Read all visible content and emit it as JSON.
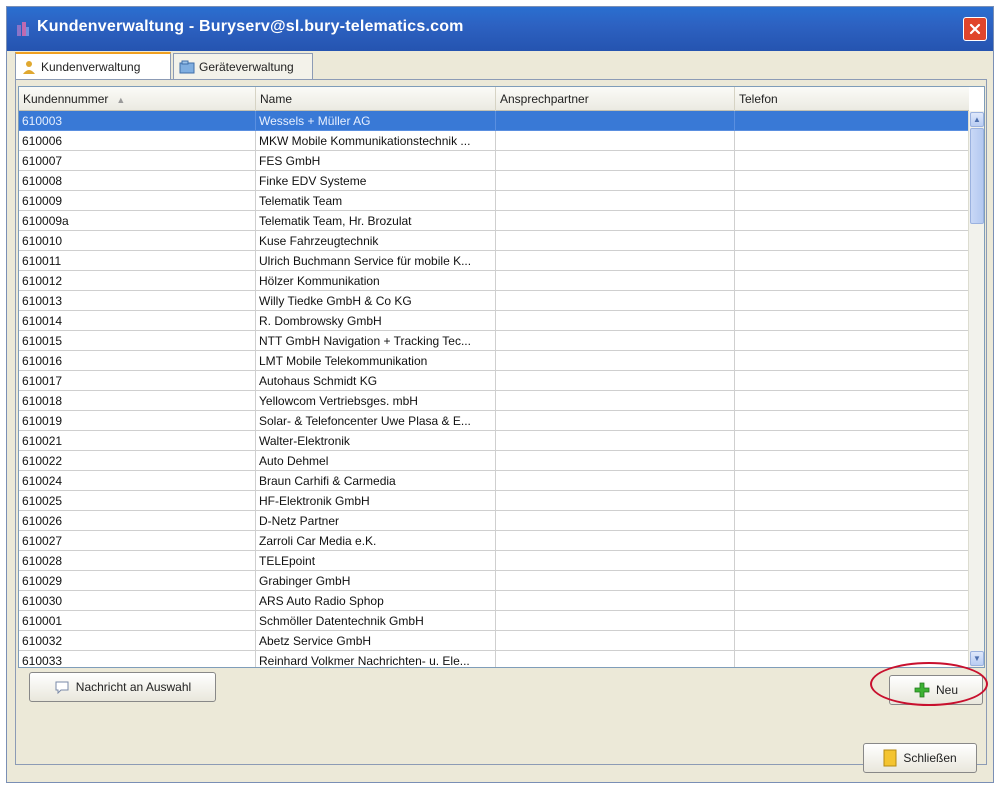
{
  "window": {
    "title": "Kundenverwaltung - Buryserv@sl.bury-telematics.com"
  },
  "tabs": [
    {
      "label": "Kundenverwaltung",
      "icon": "person-icon",
      "active": true
    },
    {
      "label": "Geräteverwaltung",
      "icon": "devices-icon",
      "active": false
    }
  ],
  "table": {
    "columns": [
      "Kundennummer",
      "Name",
      "Ansprechpartner",
      "Telefon"
    ],
    "selected_index": 0,
    "rows": [
      [
        "610003",
        "Wessels + Müller AG",
        "",
        ""
      ],
      [
        "610006",
        "MKW Mobile Kommunikationstechnik ...",
        "",
        ""
      ],
      [
        "610007",
        "FES GmbH",
        "",
        ""
      ],
      [
        "610008",
        "Finke EDV Systeme",
        "",
        ""
      ],
      [
        "610009",
        "Telematik Team",
        "",
        ""
      ],
      [
        "610009a",
        "Telematik Team, Hr. Brozulat",
        "",
        ""
      ],
      [
        "610010",
        "Kuse Fahrzeugtechnik",
        "",
        ""
      ],
      [
        "610011",
        "Ulrich Buchmann Service für mobile K...",
        "",
        ""
      ],
      [
        "610012",
        "Hölzer Kommunikation",
        "",
        ""
      ],
      [
        "610013",
        "Willy Tiedke GmbH & Co KG",
        "",
        ""
      ],
      [
        "610014",
        "R. Dombrowsky GmbH",
        "",
        ""
      ],
      [
        "610015",
        "NTT GmbH Navigation + Tracking Tec...",
        "",
        ""
      ],
      [
        "610016",
        "LMT Mobile Telekommunikation",
        "",
        ""
      ],
      [
        "610017",
        "Autohaus Schmidt KG",
        "",
        ""
      ],
      [
        "610018",
        "Yellowcom Vertriebsges. mbH",
        "",
        ""
      ],
      [
        "610019",
        "Solar- & Telefoncenter Uwe Plasa & E...",
        "",
        ""
      ],
      [
        "610021",
        "Walter-Elektronik",
        "",
        ""
      ],
      [
        "610022",
        "Auto Dehmel",
        "",
        ""
      ],
      [
        "610024",
        "Braun Carhifi & Carmedia",
        "",
        ""
      ],
      [
        "610025",
        "HF-Elektronik GmbH",
        "",
        ""
      ],
      [
        "610026",
        "D-Netz Partner",
        "",
        ""
      ],
      [
        "610027",
        "Zarroli Car Media e.K.",
        "",
        ""
      ],
      [
        "610028",
        "TELEpoint",
        "",
        ""
      ],
      [
        "610029",
        "Grabinger GmbH",
        "",
        ""
      ],
      [
        "610030",
        "ARS Auto Radio Sphop",
        "",
        ""
      ],
      [
        "610001",
        "Schmöller Datentechnik GmbH",
        "",
        ""
      ],
      [
        "610032",
        "Abetz Service GmbH",
        "",
        ""
      ],
      [
        "610033",
        "Reinhard Volkmer Nachrichten- u. Ele...",
        "",
        ""
      ]
    ]
  },
  "buttons": {
    "message": "Nachricht an Auswahl",
    "new": "Neu",
    "close": "Schließen"
  },
  "colors": {
    "titlebar": "#2d62c2",
    "selection": "#3979d6",
    "highlight": "#c8102e"
  }
}
